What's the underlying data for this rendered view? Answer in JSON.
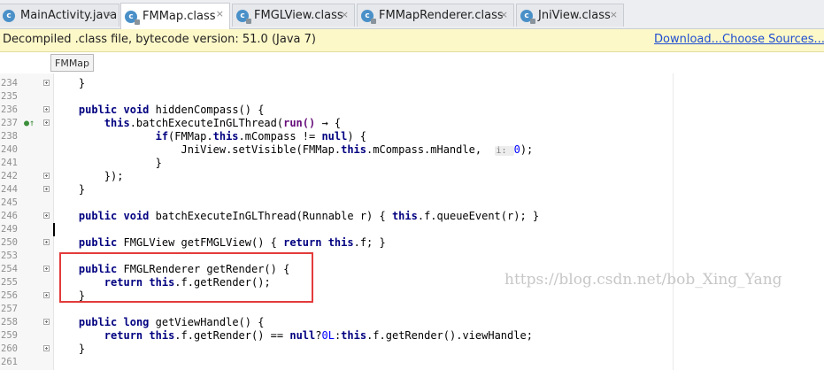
{
  "tabs": [
    {
      "label": "MainActivity.java",
      "icon": "c",
      "close": "×",
      "active": false
    },
    {
      "label": "FMMap.class",
      "icon": "c",
      "close": "×",
      "active": true
    },
    {
      "label": "FMGLView.class",
      "icon": "c",
      "close": "×",
      "active": false
    },
    {
      "label": "FMMapRenderer.class",
      "icon": "c",
      "close": "×",
      "active": false
    },
    {
      "label": "JniView.class",
      "icon": "c",
      "close": "×",
      "active": false
    }
  ],
  "banner": {
    "message": "Decompiled .class file, bytecode version: 51.0 (Java 7)",
    "download_label": "Download...",
    "choose_sources_label": "Choose Sources..."
  },
  "breadcrumb": "FMMap",
  "lines": [
    {
      "num": "234",
      "text": "    }"
    },
    {
      "num": "235",
      "text": ""
    },
    {
      "num": "236",
      "text": "    public void hiddenCompass() {"
    },
    {
      "num": "237",
      "text": "        this.batchExecuteInGLThread(run() → {"
    },
    {
      "num": "238",
      "text": "                if(FMMap.this.mCompass != null) {"
    },
    {
      "num": "240",
      "text": "                    JniView.setVisible(FMMap.this.mCompass.mHandle,  i: 0);"
    },
    {
      "num": "241",
      "text": "                }"
    },
    {
      "num": "242",
      "text": "        });"
    },
    {
      "num": "244",
      "text": "    }"
    },
    {
      "num": "245",
      "text": ""
    },
    {
      "num": "246",
      "text": "    public void batchExecuteInGLThread(Runnable r) { this.f.queueEvent(r); }"
    },
    {
      "num": "249",
      "text": ""
    },
    {
      "num": "250",
      "text": "    public FMGLView getFMGLView() { return this.f; }"
    },
    {
      "num": "253",
      "text": ""
    },
    {
      "num": "254",
      "text": "    public FMGLRenderer getRender() {"
    },
    {
      "num": "255",
      "text": "        return this.f.getRender();"
    },
    {
      "num": "256",
      "text": "    }"
    },
    {
      "num": "257",
      "text": ""
    },
    {
      "num": "258",
      "text": "    public long getViewHandle() {"
    },
    {
      "num": "259",
      "text": "        return this.f.getRender() == null?0L:this.f.getRender().viewHandle;"
    },
    {
      "num": "260",
      "text": "    }"
    },
    {
      "num": "261",
      "text": ""
    }
  ],
  "watermark": "https://blog.csdn.net/bob_Xing_Yang",
  "colors": {
    "highlight_box": "#e33b3b",
    "banner_bg": "#fdf8c8",
    "link": "#1f4fd1"
  }
}
